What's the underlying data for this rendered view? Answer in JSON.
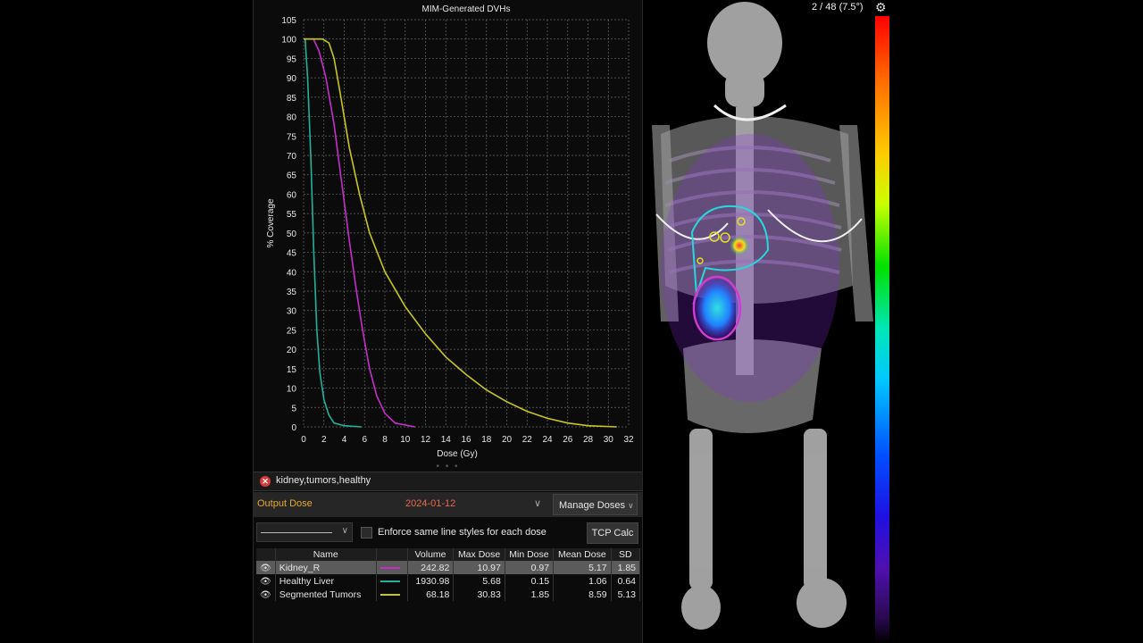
{
  "chart_data": {
    "type": "line",
    "title": "MIM-Generated DVHs",
    "xlabel": "Dose (Gy)",
    "ylabel": "% Coverage",
    "xlim": [
      0,
      32
    ],
    "ylim": [
      0,
      105
    ],
    "xticks": [
      0,
      2,
      4,
      6,
      8,
      10,
      12,
      14,
      16,
      18,
      20,
      22,
      24,
      26,
      28,
      30,
      32
    ],
    "yticks": [
      0,
      5,
      10,
      15,
      20,
      25,
      30,
      35,
      40,
      45,
      50,
      55,
      60,
      65,
      70,
      75,
      80,
      85,
      90,
      95,
      100,
      105
    ],
    "grid": true,
    "series": [
      {
        "name": "Healthy Liver",
        "color": "#1fb39a",
        "points": [
          [
            0,
            100
          ],
          [
            0.15,
            100
          ],
          [
            0.4,
            90
          ],
          [
            0.7,
            70
          ],
          [
            1.0,
            45
          ],
          [
            1.3,
            25
          ],
          [
            1.6,
            14
          ],
          [
            2.0,
            7
          ],
          [
            2.5,
            3
          ],
          [
            3.0,
            1
          ],
          [
            4.0,
            0.3
          ],
          [
            5.68,
            0
          ]
        ]
      },
      {
        "name": "Kidney_R",
        "color": "#c62ec9",
        "points": [
          [
            0,
            100
          ],
          [
            0.97,
            100
          ],
          [
            1.5,
            97
          ],
          [
            2.2,
            90
          ],
          [
            3.0,
            78
          ],
          [
            3.8,
            62
          ],
          [
            4.5,
            48
          ],
          [
            5.2,
            35
          ],
          [
            5.8,
            25
          ],
          [
            6.5,
            15
          ],
          [
            7.2,
            8
          ],
          [
            8.0,
            3.5
          ],
          [
            9.0,
            1
          ],
          [
            10.97,
            0
          ]
        ]
      },
      {
        "name": "Segmented Tumors",
        "color": "#c8c71a",
        "points": [
          [
            0,
            100
          ],
          [
            1.85,
            100
          ],
          [
            2.5,
            99
          ],
          [
            3.0,
            95
          ],
          [
            3.6,
            86
          ],
          [
            4.5,
            72
          ],
          [
            5.5,
            60
          ],
          [
            6.5,
            50
          ],
          [
            8,
            40
          ],
          [
            10,
            31
          ],
          [
            12,
            24
          ],
          [
            14,
            18
          ],
          [
            16,
            13.5
          ],
          [
            18,
            9.5
          ],
          [
            20,
            6.5
          ],
          [
            22,
            4
          ],
          [
            24,
            2.2
          ],
          [
            26,
            1
          ],
          [
            28,
            0.3
          ],
          [
            30.83,
            0
          ]
        ]
      }
    ]
  },
  "filter": {
    "text": "kidney,tumors,healthy"
  },
  "dose": {
    "name": "Output Dose",
    "date": "2024-01-12",
    "manage_label": "Manage Doses"
  },
  "options": {
    "enforce_label": "Enforce same line styles for each dose",
    "tcp_label": "TCP Calc"
  },
  "table": {
    "headers": [
      "Name",
      "Volume",
      "Max Dose",
      "Min Dose",
      "Mean Dose",
      "SD"
    ],
    "rows": [
      {
        "name": "Kidney_R",
        "color": "#c62ec9",
        "volume": "242.82",
        "max": "10.97",
        "min": "0.97",
        "mean": "5.17",
        "sd": "1.85"
      },
      {
        "name": "Healthy Liver",
        "color": "#1fb39a",
        "volume": "1930.98",
        "max": "5.68",
        "min": "0.15",
        "mean": "1.06",
        "sd": "0.64"
      },
      {
        "name": "Segmented Tumors",
        "color": "#c8c71a",
        "volume": "68.18",
        "max": "30.83",
        "min": "1.85",
        "mean": "8.59",
        "sd": "5.13"
      }
    ]
  },
  "viewer": {
    "slice_label": "2 / 48 (7.5°)",
    "settings_icon": "gear-icon"
  }
}
